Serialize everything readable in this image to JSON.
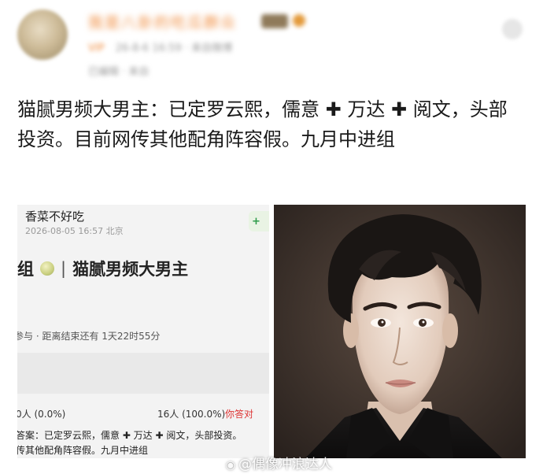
{
  "header": {
    "username": "我是八卦的吃瓜群众",
    "meta_line": "26-8-6 16:59 · 来自微博",
    "meta_tag": "VIP",
    "meta_line2": "已编辑 · 来自"
  },
  "post": {
    "text": "猫腻男频大男主：已定罗云熙，儒意 ✚ 万达 ✚ 阅文，头部投资。目前网传其他配角阵容假。九月中进组"
  },
  "screenshot": {
    "user": "香菜不好吃",
    "time": "2026-08-05 16:57 北京",
    "follow_label": "+ ",
    "title_prefix": "组",
    "title_sep": "|",
    "title_main": "猫腻男频大男主",
    "vote_info": "参与 · 距离结束还有 1天22时55分",
    "result_a": "0人 (0.0%)",
    "result_b": "16人 (100.0%)",
    "guess_label": "你答对",
    "answer_line1": "答案：已定罗云熙，儒意 ✚ 万达 ✚ 阅文，头部投资。",
    "answer_line2": "传其他配角阵容假。九月中进组"
  },
  "watermark": {
    "text": "@偶像冲浪达人",
    "icon": "weibo-icon"
  }
}
